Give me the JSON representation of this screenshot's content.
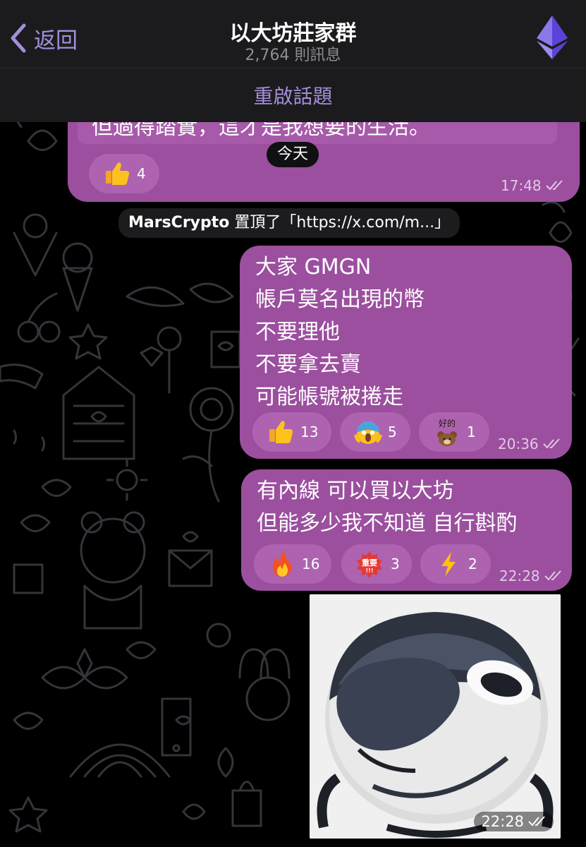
{
  "header": {
    "back_label": "返回",
    "title": "以大坊莊家群",
    "subtitle": "2,764 則訊息",
    "topic_label": "重啟話題"
  },
  "messages": [
    {
      "text_lines": [
        "但過得踏實，這才是我想要的生活。"
      ],
      "reactions": [
        {
          "emoji": "thumbs-up",
          "count": "4"
        }
      ],
      "time": "17:48"
    },
    {
      "text_lines": [
        "大家 GMGN",
        "帳戶莫名出現的幣",
        "不要理他",
        "不要拿去賣",
        "可能帳號被捲走"
      ],
      "reactions": [
        {
          "emoji": "thumbs-up",
          "count": "13"
        },
        {
          "emoji": "screaming-face",
          "count": "5"
        },
        {
          "emoji": "bear-sticker",
          "count": "1",
          "sticker_text": "好的"
        }
      ],
      "time": "20:36"
    },
    {
      "text_lines": [
        "有內線 可以買以大坊",
        "但能多少我不知道 自行斟酌"
      ],
      "reactions": [
        {
          "emoji": "fire",
          "count": "16"
        },
        {
          "emoji": "important-sticker",
          "count": "3",
          "sticker_text": "重要"
        },
        {
          "emoji": "lightning",
          "count": "2"
        }
      ],
      "time": "22:28"
    }
  ],
  "photo_message": {
    "time": "22:28"
  },
  "date_pill": "今天",
  "service_message": {
    "user": "MarsCrypto",
    "action": " 置頂了「https://x.com/m...」"
  },
  "colors": {
    "bubble": "#9b4f9e",
    "reaction": "#ad63b0",
    "accent": "#a48fda",
    "header_bg": "#1b1b1d",
    "background": "#000000"
  },
  "icons": {
    "back": "chevron-left-icon",
    "avatar": "ethereum-logo",
    "read": "double-check-icon"
  }
}
